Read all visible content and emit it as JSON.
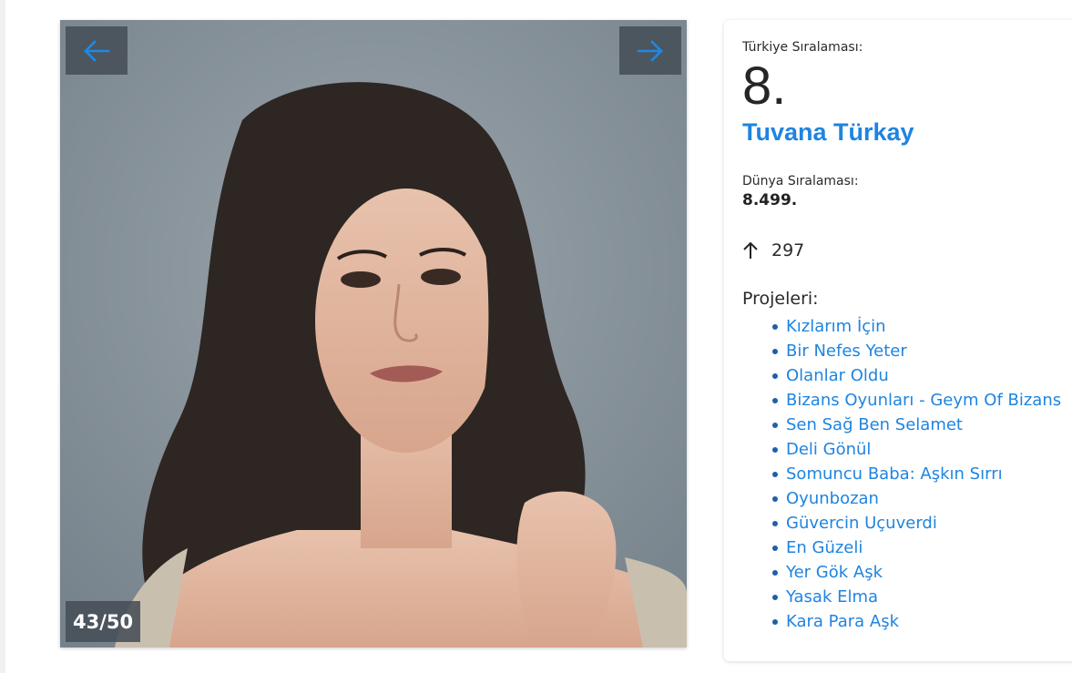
{
  "gallery": {
    "counter": "43/50",
    "prev_icon": "arrow-left-icon",
    "next_icon": "arrow-right-icon",
    "nav_arrow_color": "#1e88e5",
    "image_alt": "Tuvana Türkay"
  },
  "profile": {
    "turkey_rank_label": "Türkiye Sıralaması:",
    "turkey_rank": "8.",
    "name": "Tuvana Türkay",
    "world_rank_label": "Dünya Sıralaması:",
    "world_rank": "8.499.",
    "change_icon": "arrow-up-icon",
    "change_value": "297",
    "projects_label": "Projeleri:",
    "projects": [
      "Kızlarım İçin",
      "Bir Nefes Yeter",
      "Olanlar Oldu",
      "Bizans Oyunları - Geym Of Bizans",
      "Sen Sağ Ben Selamet",
      "Deli Gönül",
      "Somuncu Baba: Aşkın Sırrı",
      "Oyunbozan",
      "Güvercin Uçuverdi",
      "En Güzeli",
      "Yer Gök Aşk",
      "Yasak Elma",
      "Kara Para Aşk"
    ],
    "link_color": "#1f84e0"
  }
}
